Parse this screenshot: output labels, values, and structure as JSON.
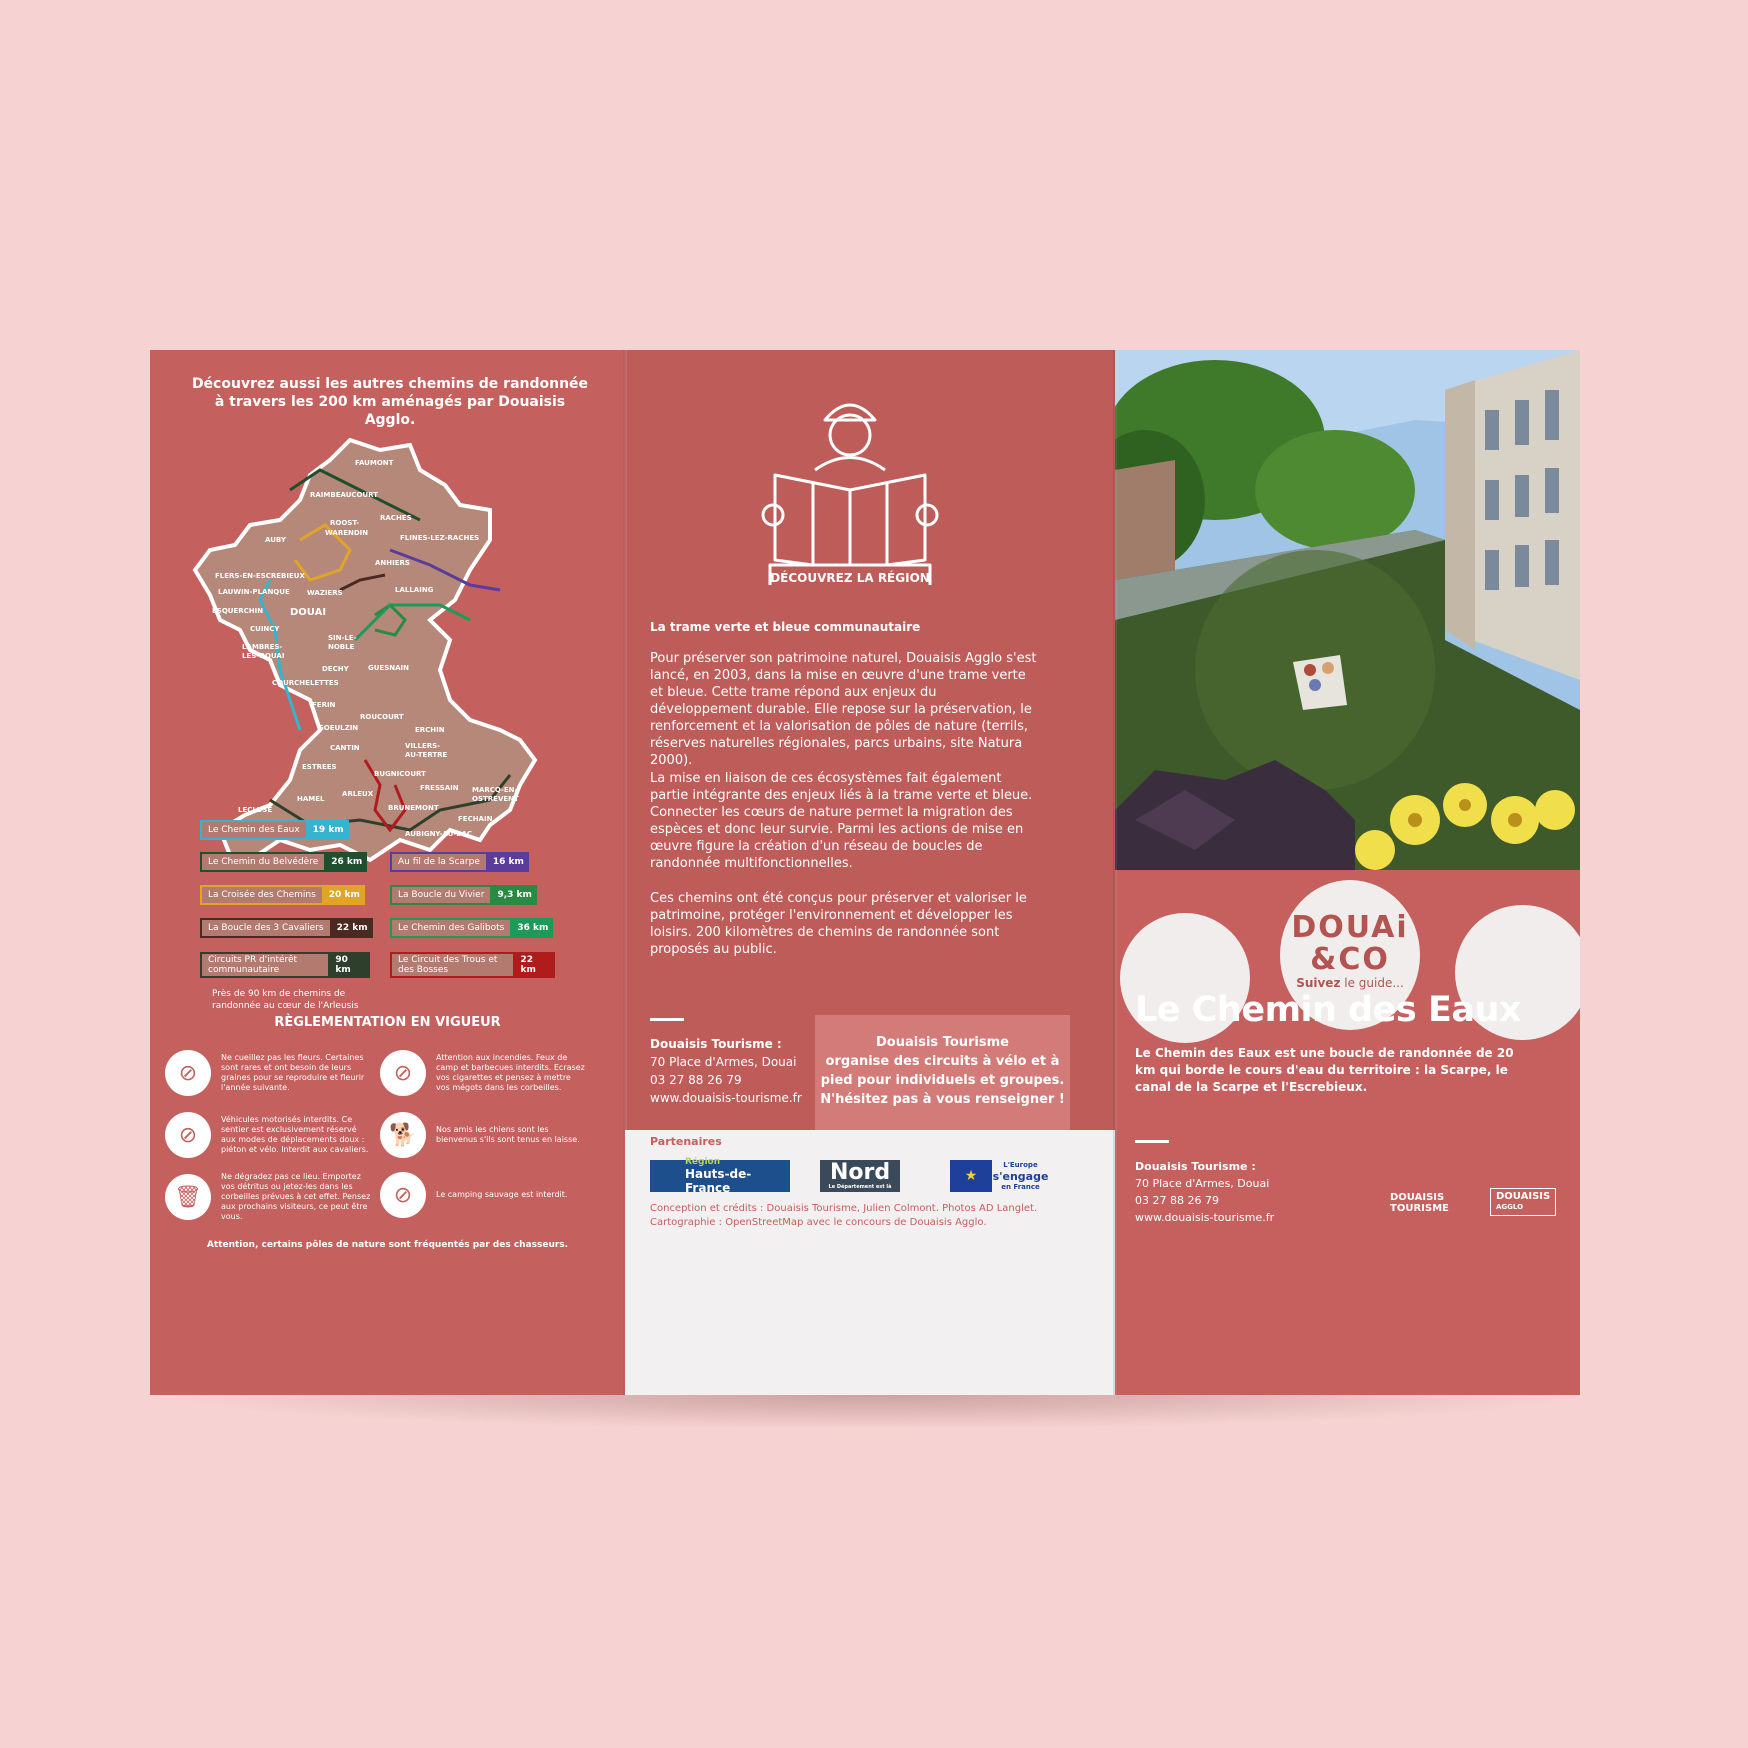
{
  "left_panel": {
    "title_line1": "Découvrez aussi les autres chemins de randonnée",
    "title_line2": "à travers les 200 km aménagés par Douaisis Agglo.",
    "towns": [
      "FAUMONT",
      "RAIMBEAUCOURT",
      "ROOST-",
      "WARENDIN",
      "RACHES",
      "AUBY",
      "FLINES-LEZ-RACHES",
      "ANHIERS",
      "FLERS-EN-ESCREBIEUX",
      "LALLAING",
      "LAUWIN-PLANQUE",
      "WAZIERS",
      "ESQUERCHIN",
      "DOUAI",
      "CUINCY",
      "SIN-LE-",
      "NOBLE",
      "LAMBRES-",
      "LES-DOUAI",
      "GUESNAIN",
      "DECHY",
      "COURCHELETTES",
      "FERIN",
      "ROUCOURT",
      "GOEULZIN",
      "ERCHIN",
      "CANTIN",
      "VILLERS-",
      "AU-TERTRE",
      "ESTREES",
      "BUGNICOURT",
      "FRESSAIN",
      "MARCQ-EN-",
      "OSTREVENT",
      "ARLEUX",
      "HAMEL",
      "BRUNEMONT",
      "FECHAIN",
      "LECLUSE",
      "AUBIGNY-AU-BAC"
    ],
    "legend": [
      {
        "label": "Le Chemin des Eaux",
        "km": "19 km",
        "color": "#35b3cf"
      },
      {
        "label": "Le Chemin du Belvédère",
        "km": "26 km",
        "color": "#1f4f2f"
      },
      {
        "label": "Au fil de la Scarpe",
        "km": "16 km",
        "color": "#5a3c9a"
      },
      {
        "label": "La Croisée des Chemins",
        "km": "20 km",
        "color": "#e0a527"
      },
      {
        "label": "La Boucle du Vivier",
        "km": "9,3 km",
        "color": "#2a8a44"
      },
      {
        "label": "La Boucle des 3 Cavaliers",
        "km": "22 km",
        "color": "#4a2a20"
      },
      {
        "label": "Le Chemin des Galibots",
        "km": "36 km",
        "color": "#1e9a58"
      },
      {
        "label": "Circuits PR d'intérêt communautaire",
        "km": "90 km",
        "color": "#2e3f2c"
      },
      {
        "label": "Le Circuit des Trous et des Bosses",
        "km": "22 km",
        "color": "#b01c1c"
      }
    ],
    "legend_note_1": "Près de 90 km de chemins de",
    "legend_note_2": "randonnée au cœur de l'Arleusis",
    "rules_title": "RÈGLEMENTATION EN VIGUEUR",
    "rules": [
      {
        "icon": "no-flower-picking-icon",
        "text": "Ne cueillez pas les fleurs. Certaines sont rares et ont besoin de leurs graines pour se reproduire et fleurir l'année suivante."
      },
      {
        "icon": "no-fire-icon",
        "text": "Attention aux incendies. Feux de camp et barbecues interdits. Ecrasez vos cigarettes et pensez à mettre vos mégots dans les corbeilles."
      },
      {
        "icon": "no-motor-vehicle-icon",
        "text": "Véhicules motorisés interdits. Ce sentier est exclusivement réservé aux modes de déplacements doux : piéton et vélo. Interdit aux cavaliers."
      },
      {
        "icon": "dog-on-leash-icon",
        "text": "Nos amis les chiens sont les bienvenus s'ils sont tenus en laisse."
      },
      {
        "icon": "litter-bin-icon",
        "text": "Ne dégradez pas ce lieu. Emportez vos détritus ou jetez-les dans les corbeilles prévues à cet effet. Pensez aux prochains visiteurs, ce peut être vous."
      },
      {
        "icon": "no-camping-icon",
        "text": "Le camping sauvage est interdit."
      }
    ],
    "footer": "Attention, certains pôles de nature sont fréquentés par des chasseurs."
  },
  "middle_panel": {
    "icon_caption": "DÉCOUVREZ LA RÉGION",
    "heading": "La trame verte et bleue communautaire",
    "para1": "Pour préserver son patrimoine naturel, Douaisis Agglo s'est lancé, en 2003, dans la mise en œuvre d'une trame verte et bleue. Cette trame répond aux enjeux du développement durable. Elle repose sur la préservation, le renforcement et la valorisation de pôles de nature (terrils, réserves naturelles régionales, parcs urbains, site Natura 2000).",
    "para2": "La mise en liaison de ces écosystèmes fait également partie intégrante des enjeux liés à la trame verte et bleue. Connecter les cœurs de nature permet la migration des espèces et donc leur survie. Parmi les actions de mise en œuvre figure la création d'un réseau de boucles de randonnée multifonctionnelles.",
    "para3": "Ces chemins ont été conçus pour préserver et valoriser le patrimoine, protéger l'environnement et développer les loisirs. 200 kilomètres de chemins de randonnée sont proposés au public.",
    "contact_name": "Douaisis Tourisme :",
    "contact_address": "70 Place d'Armes, Douai",
    "contact_phone": "03 27 88 26 79",
    "contact_web": "www.douaisis-tourisme.fr",
    "box_line1": "Douaisis Tourisme",
    "box_line2": "organise des circuits à vélo et à",
    "box_line3": "pied pour individuels et groupes.",
    "box_line4": "N'hésitez pas à vous renseigner !",
    "partners_title": "Partenaires",
    "partner_region_1": "Région",
    "partner_region_2": "Hauts-de-France",
    "partner_nord": "Nord",
    "partner_nord_sub": "Le Département est là",
    "partner_eu_1": "L'Europe",
    "partner_eu_2": "s'engage",
    "partner_eu_3": "en France",
    "credits_1": "Conception et crédits : Douaisis Tourisme, Julien Colmont. Photos AD Langlet.",
    "credits_2": "Cartographie : OpenStreetMap avec le concours de Douaisis Agglo."
  },
  "right_panel": {
    "brand_1": "DOUAi",
    "brand_2": "&CO",
    "brand_tagline_bold": "Suivez",
    "brand_tagline": " le guide...",
    "title": "Le Chemin des Eaux",
    "description": "Le Chemin des Eaux est une boucle de randonnée de 20 km qui borde le cours d'eau du territoire : la Scarpe, le canal de la Scarpe et l'Escrebieux.",
    "contact_name": "Douaisis Tourisme :",
    "contact_address": "70 Place d'Armes, Douai",
    "contact_phone": "03 27 88 26 79",
    "contact_web": "www.douaisis-tourisme.fr",
    "logo_tourisme_1": "DOUAISIS",
    "logo_tourisme_2": "TOURISME",
    "logo_agglo_1": "DOUAISIS",
    "logo_agglo_2": "AGGLO"
  }
}
